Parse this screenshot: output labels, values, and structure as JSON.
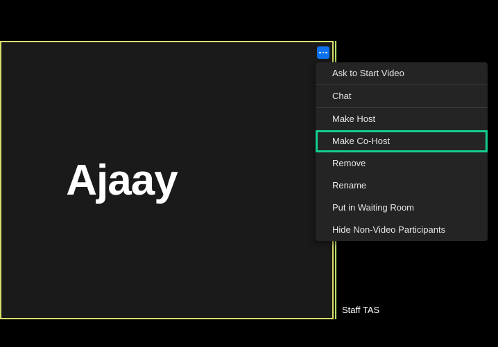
{
  "large_tile": {
    "participant_name": "Ajaay"
  },
  "small_tile": {
    "participant_label": "Staff TAS"
  },
  "more_button": {
    "icon_name": "more-options"
  },
  "context_menu": {
    "items": [
      {
        "label": "Ask to Start Video"
      },
      {
        "label": "Chat"
      }
    ],
    "items2": [
      {
        "label": "Make Host"
      },
      {
        "label": "Make Co-Host",
        "highlighted": true
      },
      {
        "label": "Remove"
      },
      {
        "label": "Rename"
      },
      {
        "label": "Put in Waiting Room"
      },
      {
        "label": "Hide Non-Video Participants"
      }
    ]
  }
}
